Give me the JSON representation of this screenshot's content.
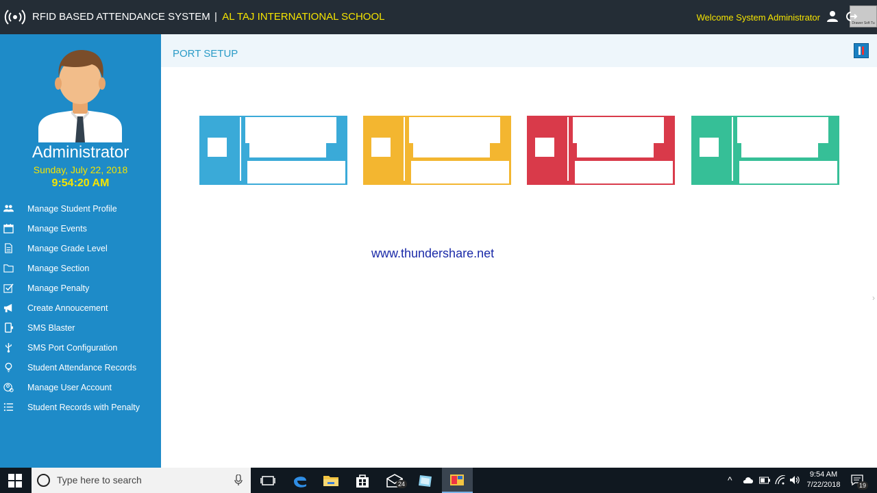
{
  "header": {
    "title": "RFID BASED ATTENDANCE SYSTEM",
    "separator": "|",
    "school": "AL TAJ INTERNATIONAL SCHOOL",
    "welcome": "Welcome System Administrator",
    "drawer_label": "Drawer Soft Tu"
  },
  "profile": {
    "name": "Administrator",
    "date": "Sunday, July 22, 2018",
    "time": "9:54:20 AM"
  },
  "menu": [
    {
      "label": "Manage Student Profile",
      "icon": "users-icon"
    },
    {
      "label": "Manage Events",
      "icon": "calendar-icon"
    },
    {
      "label": "Manage Grade Level",
      "icon": "document-icon"
    },
    {
      "label": "Manage Section",
      "icon": "folder-icon"
    },
    {
      "label": "Manage Penalty",
      "icon": "checkbox-icon"
    },
    {
      "label": "Create Annoucement",
      "icon": "megaphone-icon"
    },
    {
      "label": "SMS Blaster",
      "icon": "mobile-icon"
    },
    {
      "label": "SMS Port Configuration",
      "icon": "usb-icon"
    },
    {
      "label": "Student Attendance Records",
      "icon": "lightbulb-icon"
    },
    {
      "label": "Manage User Account",
      "icon": "user-settings-icon"
    },
    {
      "label": "Student Records with Penalty",
      "icon": "list-icon"
    }
  ],
  "main": {
    "page_title": "PORT SETUP",
    "watermark": "www.thundershare.net",
    "tiles": [
      {
        "color": "#3aaad8"
      },
      {
        "color": "#f3b630"
      },
      {
        "color": "#d93a4a"
      },
      {
        "color": "#36bf97"
      }
    ]
  },
  "taskbar": {
    "search_placeholder": "Type here to search",
    "mail_badge": "24",
    "notif_badge": "19",
    "clock_time": "9:54 AM",
    "clock_date": "7/22/2018"
  },
  "colors": {
    "header_bg": "#242d36",
    "sidebar_bg": "#1e8bc8",
    "accent_yellow": "#f5e400",
    "title_blue": "#2a9bc7"
  }
}
